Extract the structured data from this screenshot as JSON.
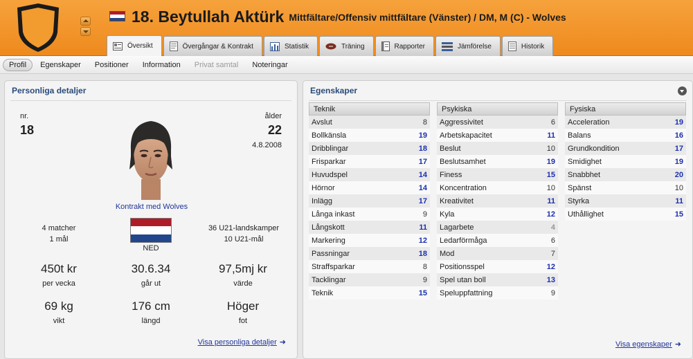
{
  "header": {
    "number_and_name": "18. Beytullah Aktürk",
    "positions": "Mittfältare/Offensiv mittfältare (Vänster) / DM, M (C) - Wolves",
    "flag_colors": [
      "#ae1c28",
      "#ffffff",
      "#21468b"
    ]
  },
  "tabs": [
    {
      "label": "Översikt",
      "icon": "overview-icon",
      "active": true
    },
    {
      "label": "Övergångar & Kontrakt",
      "icon": "contract-icon"
    },
    {
      "label": "Statistik",
      "icon": "stats-icon"
    },
    {
      "label": "Träning",
      "icon": "training-icon"
    },
    {
      "label": "Rapporter",
      "icon": "report-icon"
    },
    {
      "label": "Jämförelse",
      "icon": "compare-icon"
    },
    {
      "label": "Historik",
      "icon": "history-icon"
    }
  ],
  "subnav": [
    {
      "label": "Profil",
      "state": "active"
    },
    {
      "label": "Egenskaper"
    },
    {
      "label": "Positioner"
    },
    {
      "label": "Information"
    },
    {
      "label": "Privat samtal",
      "state": "disabled"
    },
    {
      "label": "Noteringar"
    }
  ],
  "personal": {
    "title": "Personliga detaljer",
    "nr_label": "nr.",
    "nr_value": "18",
    "age_label": "ålder",
    "age_value": "22",
    "birth_date": "4.8.2008",
    "contract": "Kontrakt med Wolves",
    "club_caps": "4 matcher",
    "club_goals": "1 mål",
    "nation": "NED",
    "intl_caps": "36 U21-landskamper",
    "intl_goals": "10 U21-mål",
    "wage_value": "450t kr",
    "wage_label": "per vecka",
    "expires_value": "30.6.34",
    "expires_label": "går ut",
    "worth_value": "97,5mj kr",
    "worth_label": "värde",
    "weight_value": "69 kg",
    "weight_label": "vikt",
    "height_value": "176 cm",
    "height_label": "längd",
    "foot_value": "Höger",
    "foot_label": "fot",
    "link": "Visa personliga detaljer"
  },
  "attributes": {
    "title": "Egenskaper",
    "link": "Visa egenskaper",
    "technical": {
      "head": "Teknik",
      "items": [
        {
          "name": "Avslut",
          "value": "8"
        },
        {
          "name": "Bollkänsla",
          "value": "19"
        },
        {
          "name": "Dribblingar",
          "value": "18"
        },
        {
          "name": "Frisparkar",
          "value": "17"
        },
        {
          "name": "Huvudspel",
          "value": "14"
        },
        {
          "name": "Hörnor",
          "value": "14"
        },
        {
          "name": "Inlägg",
          "value": "17"
        },
        {
          "name": "Långa inkast",
          "value": "9"
        },
        {
          "name": "Långskott",
          "value": "11"
        },
        {
          "name": "Markering",
          "value": "12"
        },
        {
          "name": "Passningar",
          "value": "18"
        },
        {
          "name": "Straffsparkar",
          "value": "8"
        },
        {
          "name": "Tacklingar",
          "value": "9"
        },
        {
          "name": "Teknik",
          "value": "15"
        }
      ]
    },
    "mental": {
      "head": "Psykiska",
      "items": [
        {
          "name": "Aggressivitet",
          "value": "6"
        },
        {
          "name": "Arbetskapacitet",
          "value": "11"
        },
        {
          "name": "Beslut",
          "value": "10"
        },
        {
          "name": "Beslutsamhet",
          "value": "19"
        },
        {
          "name": "Finess",
          "value": "15"
        },
        {
          "name": "Koncentration",
          "value": "10"
        },
        {
          "name": "Kreativitet",
          "value": "11"
        },
        {
          "name": "Kyla",
          "value": "12"
        },
        {
          "name": "Lagarbete",
          "value": "4"
        },
        {
          "name": "Ledarförmåga",
          "value": "6"
        },
        {
          "name": "Mod",
          "value": "7"
        },
        {
          "name": "Positionsspel",
          "value": "12"
        },
        {
          "name": "Spel utan boll",
          "value": "13"
        },
        {
          "name": "Speluppfattning",
          "value": "9"
        }
      ]
    },
    "physical": {
      "head": "Fysiska",
      "items": [
        {
          "name": "Acceleration",
          "value": "19"
        },
        {
          "name": "Balans",
          "value": "16"
        },
        {
          "name": "Grundkondition",
          "value": "17"
        },
        {
          "name": "Smidighet",
          "value": "19"
        },
        {
          "name": "Snabbhet",
          "value": "20"
        },
        {
          "name": "Spänst",
          "value": "10"
        },
        {
          "name": "Styrka",
          "value": "11"
        },
        {
          "name": "Uthållighet",
          "value": "15"
        }
      ]
    }
  }
}
